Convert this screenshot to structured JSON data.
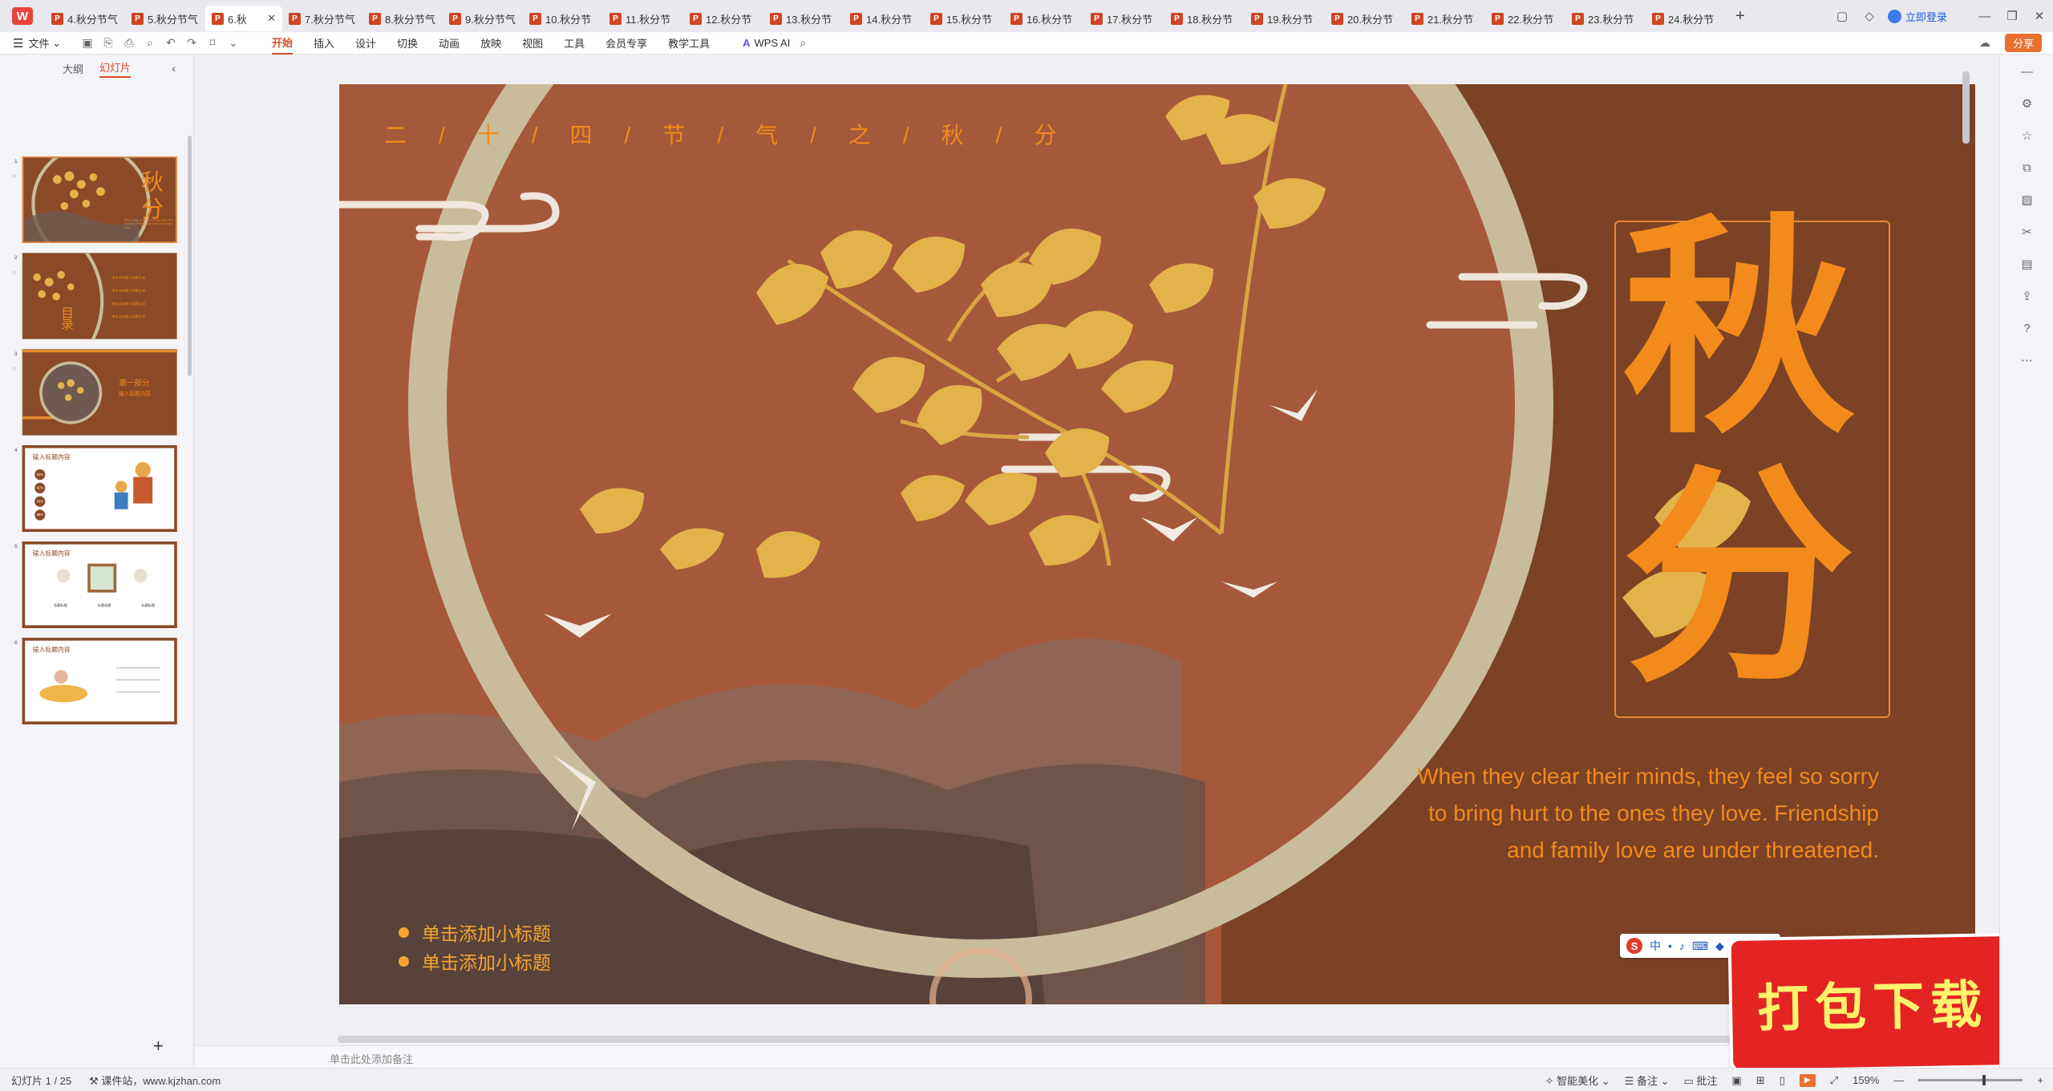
{
  "tabs": [
    {
      "label": "4.秋分节气"
    },
    {
      "label": "5.秋分节气"
    },
    {
      "label": "6.秋"
    },
    {
      "label": "7.秋分节气"
    },
    {
      "label": "8.秋分节气"
    },
    {
      "label": "9.秋分节气"
    },
    {
      "label": "10.秋分节"
    },
    {
      "label": "11.秋分节"
    },
    {
      "label": "12.秋分节"
    },
    {
      "label": "13.秋分节"
    },
    {
      "label": "14.秋分节"
    },
    {
      "label": "15.秋分节"
    },
    {
      "label": "16.秋分节"
    },
    {
      "label": "17.秋分节"
    },
    {
      "label": "18.秋分节"
    },
    {
      "label": "19.秋分节"
    },
    {
      "label": "20.秋分节"
    },
    {
      "label": "21.秋分节"
    },
    {
      "label": "22.秋分节"
    },
    {
      "label": "23.秋分节"
    },
    {
      "label": "24.秋分节"
    }
  ],
  "titlebar": {
    "login": "立即登录"
  },
  "menu": {
    "file": "文件",
    "items": [
      "开始",
      "插入",
      "设计",
      "切换",
      "动画",
      "放映",
      "视图",
      "工具",
      "会员专享",
      "教学工具"
    ],
    "wps_ai": "WPS AI",
    "share": "分享"
  },
  "left_panel": {
    "view_outline": "大纲",
    "view_slides": "幻灯片",
    "thumbs": [
      {
        "num": "1",
        "title": "秋分"
      },
      {
        "num": "2",
        "title": "目录"
      },
      {
        "num": "3",
        "title": "第一部分"
      },
      {
        "num": "4",
        "title": "输入标题内容"
      },
      {
        "num": "5",
        "title": "输入标题内容"
      },
      {
        "num": "6",
        "title": "输入标题内容"
      }
    ],
    "thumb1": {
      "desc": "When they clear their minds, they feel so sorry to bring hurt to the ones they love."
    },
    "thumb2": {
      "items": [
        "单击添加输入标题文本",
        "单击添加输入标题文本",
        "单击添加输入标题文本",
        "单击添加输入标题文本"
      ],
      "side": "目\n录"
    },
    "thumb3": {
      "title": "第一部分",
      "sub": "输入标题内容"
    },
    "thumb4": {
      "percents": [
        "93%",
        "62%",
        "70%",
        "68%"
      ]
    },
    "thumb5": {
      "labels": [
        "标题标题",
        "标题标题",
        "标题标题"
      ]
    }
  },
  "slide": {
    "top_title": "二/十/四/节/气/之/秋/分",
    "char1": "秋",
    "char2": "分",
    "english": "When they clear their minds, they feel so sorry to bring hurt to the ones they love. Friendship and family love are under threatened.",
    "subtitles": [
      "单击添加小标题",
      "单击添加小标题"
    ]
  },
  "notes": {
    "placeholder": "单击此处添加备注"
  },
  "ime": {
    "zh": "中"
  },
  "badge": {
    "text": "打包下载"
  },
  "status": {
    "slide_info": "幻灯片 1 / 25",
    "site": "课件站，www.kjzhan.com",
    "beautify": "智能美化",
    "notes": "备注",
    "comments": "批注",
    "zoom": "159%"
  },
  "colors": {
    "slide_bg": "#a5593a",
    "accent_orange": "#f28a1c",
    "gold": "#e2b34a",
    "ring": "#c9bc9a",
    "ribbon_active": "#d1502a"
  }
}
